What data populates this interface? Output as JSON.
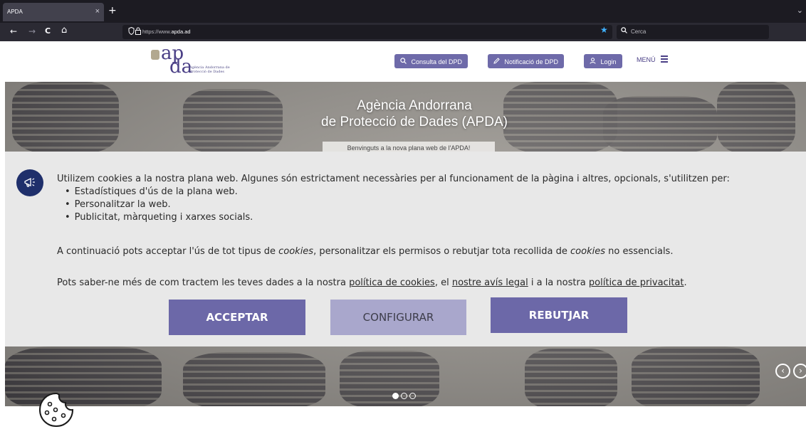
{
  "browser": {
    "tab_title": "APDA",
    "tab_close": "×",
    "new_tab": "+",
    "tabs_menu": "⌄",
    "back": "←",
    "forward": "→",
    "reload": "C",
    "home": "⌂",
    "url_prefix": "https://www.",
    "url_domain": "apda.ad",
    "search_placeholder": "Cerca"
  },
  "header": {
    "logo_word_top": "ap",
    "logo_word_bottom": "da",
    "logo_subtitle": "Agència Andorrana de Protecció de Dades",
    "consulta_label": "Consulta del DPD",
    "notificacio_label": "Notificació de DPD",
    "login_label": "Login",
    "menu_label": "MENÚ"
  },
  "hero": {
    "title_line1": "Agència Andorrana",
    "title_line2": "de Protecció de Dades (APDA)",
    "welcome": "Benvinguts a la nova plana web de l'APDA!",
    "slides_total": 3,
    "slide_active": 1
  },
  "cookie_banner": {
    "intro": "Utilizem cookies a la nostra plana web. Algunes són estrictament necessàries per al funcionament de la pàgina i altres, opcionals, s'utilitzen  per:",
    "items": [
      "Estadístiques d'ús de la plana web.",
      "Personalitzar la web.",
      "Publicitat, màrqueting i xarxes socials."
    ],
    "p2_a": "A continuació pots acceptar l'ús de tot tipus de ",
    "p2_cookies1": "cookies",
    "p2_b": ", personalitzar els permisos o rebutjar tota recollida de ",
    "p2_cookies2": "cookies",
    "p2_c": " no essencials.",
    "p3_a": "Pots saber-ne més de com tractem les teves dades a la nostra ",
    "link_cookies": "política de cookies",
    "p3_b": ", el ",
    "link_legal": "nostre avís legal",
    "p3_c": " i a la nostra ",
    "link_privacy": "política de privacitat",
    "p3_d": ".",
    "accept_label": "ACCEPTAR",
    "configure_label": "CONFIGURAR",
    "reject_label": "REBUTJAR"
  },
  "colors": {
    "accent": "#6c68a8",
    "accent_light": "#a9a7cc",
    "banner_bg": "#e8e8e8",
    "icon_bg": "#1f2f6b"
  }
}
